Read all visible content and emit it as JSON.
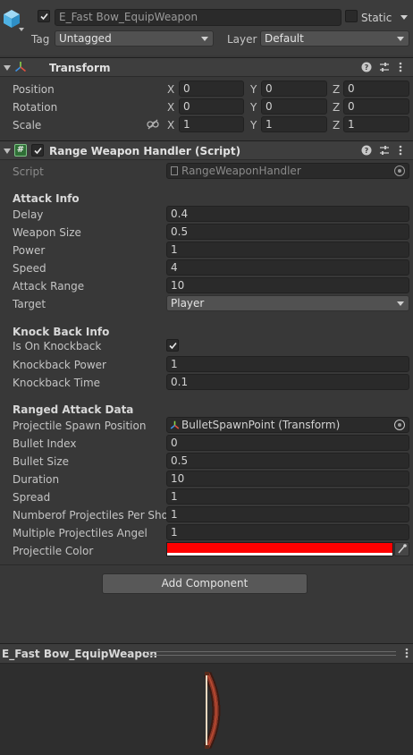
{
  "object": {
    "name": "E_Fast Bow_EquipWeapon",
    "static_label": "Static",
    "tag_label": "Tag",
    "tag_value": "Untagged",
    "layer_label": "Layer",
    "layer_value": "Default",
    "active": true,
    "static": false
  },
  "transform": {
    "title": "Transform",
    "position": {
      "label": "Position",
      "x": "0",
      "y": "0",
      "z": "0"
    },
    "rotation": {
      "label": "Rotation",
      "x": "0",
      "y": "0",
      "z": "0"
    },
    "scale": {
      "label": "Scale",
      "x": "1",
      "y": "1",
      "z": "1"
    },
    "axis": {
      "x": "X",
      "y": "Y",
      "z": "Z"
    }
  },
  "handler": {
    "title": "Range Weapon Handler (Script)",
    "script_label": "Script",
    "script_value": "RangeWeaponHandler",
    "attack_info": {
      "header": "Attack Info",
      "delay": {
        "label": "Delay",
        "value": "0.4"
      },
      "weapon_size": {
        "label": "Weapon Size",
        "value": "0.5"
      },
      "power": {
        "label": "Power",
        "value": "1"
      },
      "speed": {
        "label": "Speed",
        "value": "4"
      },
      "attack_range": {
        "label": "Attack Range",
        "value": "10"
      },
      "target": {
        "label": "Target",
        "value": "Player"
      }
    },
    "knockback_info": {
      "header": "Knock Back Info",
      "is_on_knockback": {
        "label": "Is On Knockback",
        "checked": true
      },
      "knockback_power": {
        "label": "Knockback Power",
        "value": "1"
      },
      "knockback_time": {
        "label": "Knockback Time",
        "value": "0.1"
      }
    },
    "ranged_attack_data": {
      "header": "Ranged Attack Data",
      "projectile_spawn_position": {
        "label": "Projectile Spawn Position",
        "value": "BulletSpawnPoint (Transform)"
      },
      "bullet_index": {
        "label": "Bullet Index",
        "value": "0"
      },
      "bullet_size": {
        "label": "Bullet Size",
        "value": "0.5"
      },
      "duration": {
        "label": "Duration",
        "value": "10"
      },
      "spread": {
        "label": "Spread",
        "value": "1"
      },
      "number_of_projectiles": {
        "label": "Numberof Projectiles Per Shot",
        "value": "1"
      },
      "multiple_projectiles_angle": {
        "label": "Multiple Projectiles Angel",
        "value": "1"
      },
      "projectile_color": {
        "label": "Projectile Color",
        "color": "#ff0000"
      }
    }
  },
  "add_component_label": "Add Component",
  "preview": {
    "title": "E_Fast Bow_EquipWeapon"
  },
  "colors": {
    "background": "#383838",
    "field": "#2a2a2a",
    "projectile_color": "#ff0000"
  }
}
